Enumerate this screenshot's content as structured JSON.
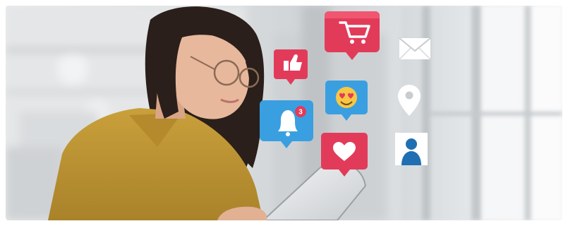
{
  "scene": {
    "description_alt": "",
    "notification_badge_count": "3",
    "icons": [
      "like-icon",
      "shopping-cart-icon",
      "mail-icon",
      "notification-bell-icon",
      "heart-eyes-emoji-icon",
      "location-pin-icon",
      "heart-icon",
      "user-profile-icon"
    ],
    "colors": {
      "pink": "#e23b5a",
      "pink_dark": "#b8243f",
      "blue": "#3a9fe0",
      "blue_dark": "#1f6fb2",
      "shirt": "#c39a35",
      "hair": "#2a1f1a",
      "skin": "#e7b89c"
    }
  }
}
